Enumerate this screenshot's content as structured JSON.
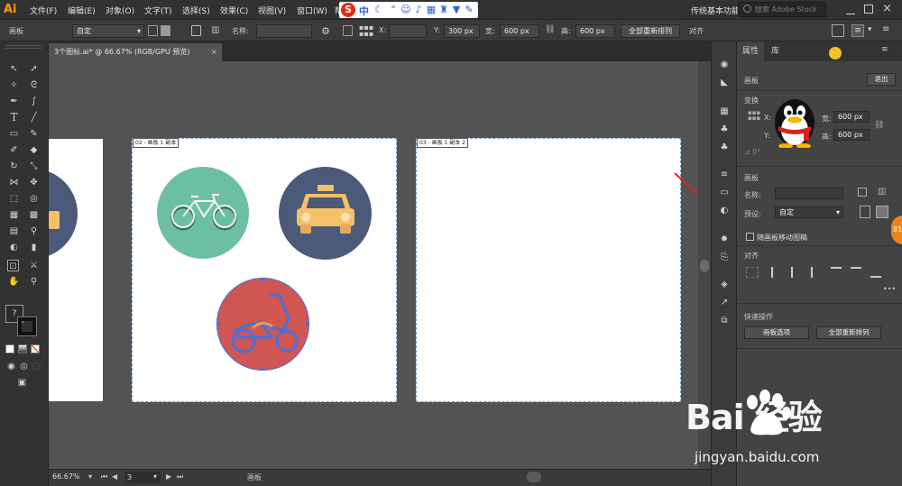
{
  "app": {
    "logo": "Ai"
  },
  "menu": [
    "文件(F)",
    "编辑(E)",
    "对象(O)",
    "文字(T)",
    "选择(S)",
    "效果(C)",
    "视图(V)",
    "窗口(W)",
    "帮"
  ],
  "ime": {
    "logo": "S",
    "mode": "中"
  },
  "workspace": {
    "label": "传统基本功能",
    "search_placeholder": "搜索 Adobe Stock"
  },
  "control": {
    "panel_label": "画板",
    "preset": "自定",
    "name_label": "名称:",
    "x_label": "X:",
    "y_label": "Y:",
    "y_value": "300 px",
    "width_label": "宽:",
    "width_value": "600 px",
    "height_label": "高:",
    "height_value": "600 px",
    "rearrange_all": "全部重新排列",
    "align": "对齐"
  },
  "document": {
    "tab_title": "3个图标.ai* @ 66.67% (RGB/GPU 预览)",
    "close": "×"
  },
  "artboards": [
    {
      "label": "02 - 画板 1 副本"
    },
    {
      "label": "03 - 画板 1 副本 2"
    }
  ],
  "icons_on_canvas": [
    "bicycle-icon",
    "taxi-icon",
    "motorcycle-icon"
  ],
  "status": {
    "zoom": "66.67%",
    "artboard_number": "3",
    "tool_name": "画板"
  },
  "panel": {
    "tabs": [
      "属性",
      "库"
    ],
    "section_artboard": "画板",
    "exit_button": "退出",
    "transform_title": "变换",
    "x_label": "X:",
    "y_label": "Y:",
    "w_label": "宽:",
    "h_label": "高:",
    "w_value": "600 px",
    "h_value": "600 px",
    "artboard_title": "画板",
    "name_label": "名称:",
    "preset_label": "预设:",
    "preset_value": "自定",
    "move_with_board_label": "随画板移动图稿",
    "align_title": "对齐",
    "quick_actions_title": "快速操作",
    "artboard_options_button": "画板选项",
    "rearrange_all_button": "全部重新排列",
    "more": "•••"
  },
  "watermark": {
    "brand": "Bai 经验",
    "url": "jingyan.baidu.com"
  },
  "badge": "81",
  "colors": {
    "bike_circle": "#6dbfa4",
    "taxi_circle": "#4b5a78",
    "moto_circle": "#cf5651",
    "taxi_body": "#f5c06a",
    "selection": "#4a6fe0",
    "ui_dark": "#323232",
    "canvas": "#535353"
  }
}
